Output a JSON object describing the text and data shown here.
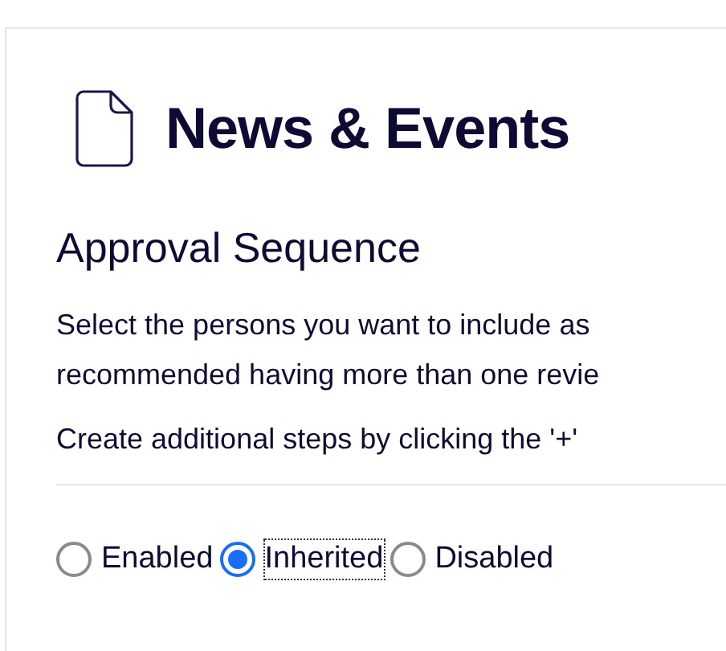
{
  "page": {
    "title": "News & Events"
  },
  "section": {
    "title": "Approval Sequence",
    "lines": [
      "Select the persons you want to include as",
      "recommended having more than one revie"
    ],
    "note": "Create additional steps by clicking the '+'"
  },
  "options": [
    {
      "label": "Enabled",
      "selected": false,
      "focused": false
    },
    {
      "label": "Inherited",
      "selected": true,
      "focused": true
    },
    {
      "label": "Disabled",
      "selected": false,
      "focused": false
    }
  ]
}
